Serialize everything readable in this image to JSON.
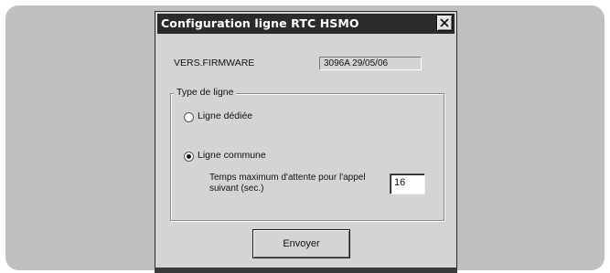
{
  "window": {
    "title": "Configuration ligne RTC HSMO"
  },
  "firmware": {
    "label": "VERS.FIRMWARE",
    "value": "3096A 29/05/06"
  },
  "line_type": {
    "group_label": "Type de ligne",
    "options": [
      {
        "label": "Ligne dédiée",
        "selected": false
      },
      {
        "label": "Ligne commune",
        "selected": true
      }
    ],
    "wait_label_line1": "Temps maximum d'attente pour l'appel",
    "wait_label_line2": "suivant (sec.)",
    "wait_value": "16"
  },
  "actions": {
    "send_label": "Envoyer"
  },
  "icons": {
    "close": "close-icon"
  }
}
